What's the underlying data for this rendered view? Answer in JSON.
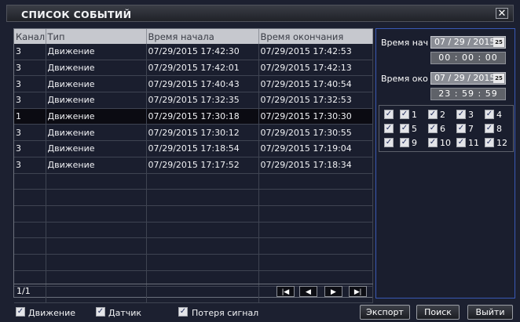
{
  "window": {
    "title": "СПИСОК СОБЫТИЙ",
    "close_glyph": "✕"
  },
  "table": {
    "headers": [
      "Канал",
      "Тип",
      "Время начала",
      "Время окончания"
    ],
    "rows": [
      [
        "3",
        "Движение",
        "07/29/2015 17:42:30",
        "07/29/2015 17:42:53"
      ],
      [
        "3",
        "Движение",
        "07/29/2015 17:42:01",
        "07/29/2015 17:42:13"
      ],
      [
        "3",
        "Движение",
        "07/29/2015 17:40:43",
        "07/29/2015 17:40:54"
      ],
      [
        "3",
        "Движение",
        "07/29/2015 17:32:35",
        "07/29/2015 17:32:53"
      ],
      [
        "1",
        "Движение",
        "07/29/2015 17:30:18",
        "07/29/2015 17:30:30"
      ],
      [
        "3",
        "Движение",
        "07/29/2015 17:30:12",
        "07/29/2015 17:30:55"
      ],
      [
        "3",
        "Движение",
        "07/29/2015 17:18:54",
        "07/29/2015 17:19:04"
      ],
      [
        "3",
        "Движение",
        "07/29/2015 17:17:52",
        "07/29/2015 17:18:34"
      ],
      [
        "",
        "",
        "",
        ""
      ],
      [
        "",
        "",
        "",
        ""
      ],
      [
        "",
        "",
        "",
        ""
      ],
      [
        "",
        "",
        "",
        ""
      ],
      [
        "",
        "",
        "",
        ""
      ],
      [
        "",
        "",
        "",
        ""
      ],
      [
        "",
        "",
        "",
        ""
      ],
      [
        "",
        "",
        "",
        ""
      ]
    ],
    "page": "1/1"
  },
  "pager": {
    "first": "|◀",
    "prev": "◀",
    "next": "▶",
    "last": "▶|"
  },
  "filter": {
    "start_label": "Время нач",
    "start_date": "07 / 29 / 2015",
    "start_time": "00 : 00 : 00",
    "end_label": "Время око",
    "end_date": "07 / 29 / 2015",
    "end_time": "23 : 59 : 59",
    "calendar_glyph": "25"
  },
  "channels": [
    {
      "label": "",
      "checked": true
    },
    {
      "label": "1",
      "checked": true
    },
    {
      "label": "2",
      "checked": true
    },
    {
      "label": "3",
      "checked": true
    },
    {
      "label": "4",
      "checked": true
    },
    {
      "label": "",
      "checked": true
    },
    {
      "label": "5",
      "checked": true
    },
    {
      "label": "6",
      "checked": true
    },
    {
      "label": "7",
      "checked": true
    },
    {
      "label": "8",
      "checked": true
    },
    {
      "label": "",
      "checked": true
    },
    {
      "label": "9",
      "checked": true
    },
    {
      "label": "10",
      "checked": true
    },
    {
      "label": "11",
      "checked": true
    },
    {
      "label": "12",
      "checked": true
    }
  ],
  "bottom": {
    "motion": "Движение",
    "sensor": "Датчик",
    "loss": "Потеря сигнал",
    "export": "Экспорт",
    "search": "Поиск",
    "exit": "Выйти"
  }
}
